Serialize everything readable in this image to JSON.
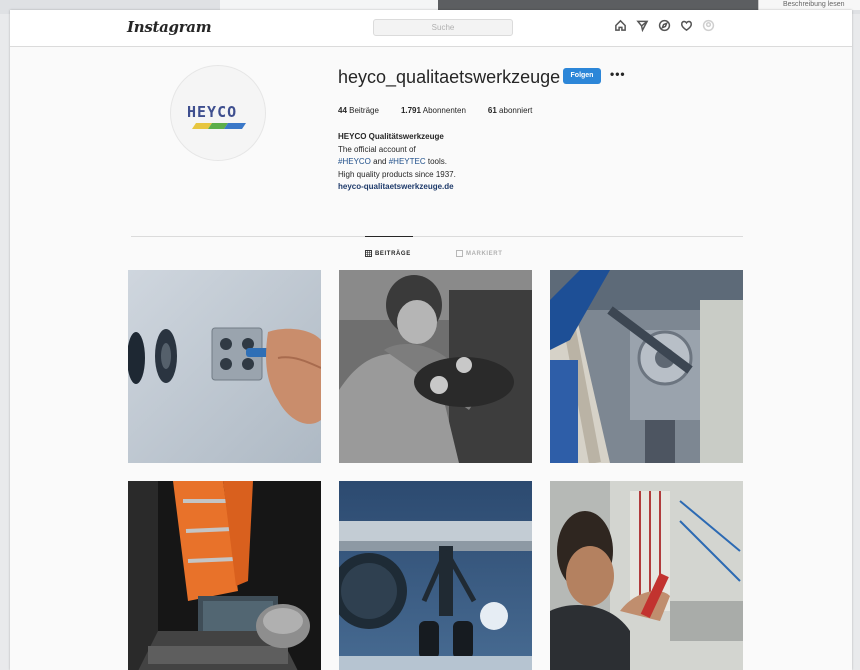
{
  "window": {
    "right_hint": "Beschreibung lesen"
  },
  "header": {
    "logo": "Instagram",
    "search_placeholder": "Suche",
    "icons": [
      "home-icon",
      "direct-message-icon",
      "explore-icon",
      "heart-icon",
      "profile-icon"
    ]
  },
  "profile": {
    "avatar_text": "HEYCO",
    "username": "heyco_qualitaetswerkzeuge",
    "follow_label": "Folgen",
    "more_label": "•••",
    "stats": {
      "posts_count": "44",
      "posts_label": "Beiträge",
      "followers_count": "1.791",
      "followers_label": "Abonnenten",
      "following_count": "61",
      "following_label": "abonniert"
    },
    "bio": {
      "name": "HEYCO Qualitätswerkzeuge",
      "line1": "The official account of",
      "tag1": "#HEYCO",
      "and": "and",
      "tag2": "#HEYTEC",
      "tools": "tools.",
      "line3": "High quality products since 1937.",
      "link": "heyco-qualitaetswerkzeuge.de"
    }
  },
  "tabs": {
    "posts": "BEITRÄGE",
    "tagged": "MARKIERT"
  },
  "colors": {
    "accent": "#2c86d8",
    "logo_blue": "#3f4f8f",
    "stripe_yellow": "#e7c640",
    "stripe_green": "#5cae4a",
    "stripe_blue": "#3a78c8"
  },
  "posts": [
    {
      "name": "post-socket-screwdriver"
    },
    {
      "name": "post-worker-bw"
    },
    {
      "name": "post-flange-wrench"
    },
    {
      "name": "post-workwear-case"
    },
    {
      "name": "post-aircraft-landing-gear"
    },
    {
      "name": "post-electrician-wiring"
    }
  ]
}
